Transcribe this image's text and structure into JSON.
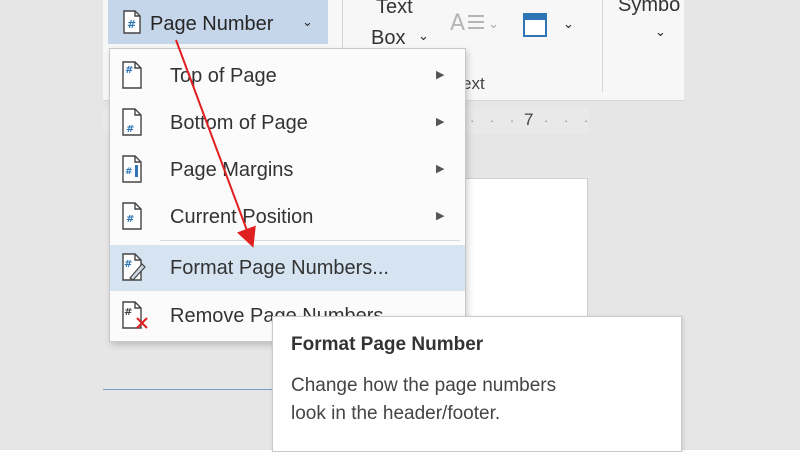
{
  "ribbon": {
    "page_number_button": {
      "label": "Page Number"
    },
    "text_box": {
      "line1": "Text",
      "line2": "Box"
    },
    "group_text_label": "ext",
    "symbol_label": "Symbo"
  },
  "ruler": {
    "number": "7"
  },
  "menu": {
    "items": [
      {
        "label": "Top of Page",
        "has_submenu": true
      },
      {
        "label": "Bottom of Page",
        "has_submenu": true
      },
      {
        "label": "Page Margins",
        "has_submenu": true
      },
      {
        "label": "Current Position",
        "has_submenu": true
      },
      {
        "label": "Format Page Numbers...",
        "has_submenu": false,
        "highlighted": true
      },
      {
        "label": "Remove Page Numbers",
        "has_submenu": false
      }
    ]
  },
  "tooltip": {
    "title": "Format Page Number",
    "description_line1": "Change how the page numbers",
    "description_line2": "look in the header/footer."
  },
  "colors": {
    "accent": "#2e75b6",
    "highlight": "#d6e4f2",
    "annotation_arrow": "#e02020",
    "remove_x": "#e02020"
  }
}
